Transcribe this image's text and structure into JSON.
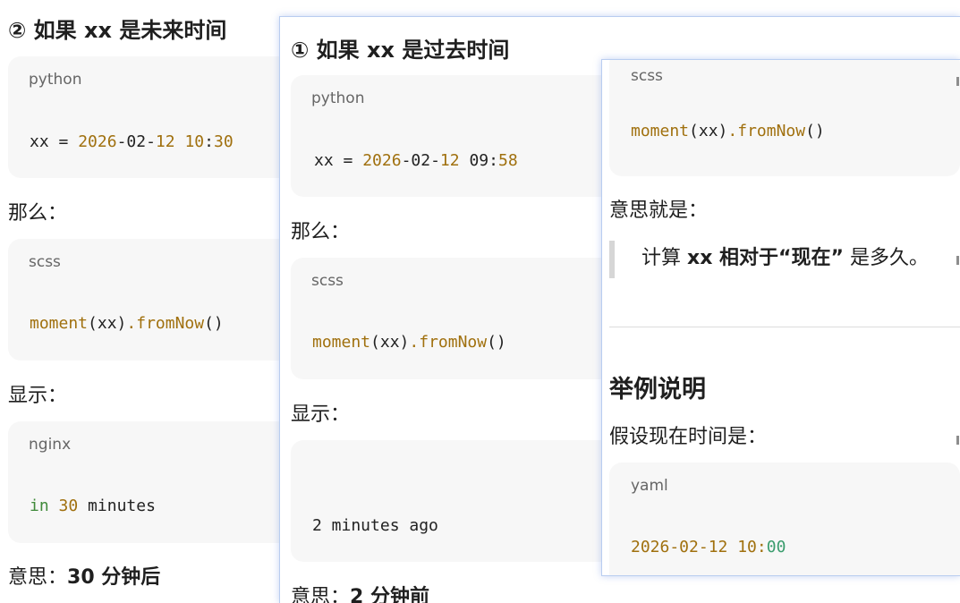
{
  "back": {
    "heading": "② 如果 xx 是未来时间",
    "code1": {
      "lang": "python",
      "var": "xx",
      "eq": " = ",
      "y": "2026",
      "d1": "-02-",
      "d": "12",
      "sp": " ",
      "h": "10",
      "colon": ":",
      "m": "30"
    },
    "then_label": "那么：",
    "code2": {
      "lang": "scss",
      "fn": "moment",
      "args": "(xx)",
      "method": ".fromNow",
      "parens": "()"
    },
    "show_label": "显示：",
    "code3": {
      "lang": "nginx",
      "kw": "in",
      "num": "30",
      "rest": " minutes"
    },
    "meaning_prefix": "意思：",
    "meaning_bold": "30 分钟后"
  },
  "mid": {
    "heading": "① 如果 xx 是过去时间",
    "code1": {
      "lang": "python",
      "var": "xx",
      "eq": " = ",
      "y": "2026",
      "d1": "-02-",
      "d": "12",
      "sp": " ",
      "h": "09",
      "colon": ":",
      "m": "58"
    },
    "then_label": "那么：",
    "code2": {
      "lang": "scss",
      "fn": "moment",
      "args": "(xx)",
      "method": ".fromNow",
      "parens": "()"
    },
    "show_label": "显示：",
    "code3": {
      "text": "2 minutes ago"
    },
    "meaning_prefix": "意思：",
    "meaning_bold": "2 分钟前"
  },
  "front": {
    "code1": {
      "lang": "scss",
      "fn": "moment",
      "args": "(xx)",
      "method": ".fromNow",
      "parens": "()"
    },
    "meaning_label": "意思就是：",
    "quote_pre": "计算 ",
    "quote_bold": "xx 相对于“现在”",
    "quote_post": " 是多久。",
    "section_heading": "举例说明",
    "assume_label": "假设现在时间是：",
    "code2": {
      "lang": "yaml",
      "date": "2026-02-12",
      "sp": " ",
      "h": "10",
      "colon": ":",
      "m": "00"
    }
  },
  "colors": {
    "code_bg": "#f7f7f7",
    "number": "#a0700e",
    "keyword": "#3f8a3a",
    "popup_border": "#b9cdf0"
  }
}
